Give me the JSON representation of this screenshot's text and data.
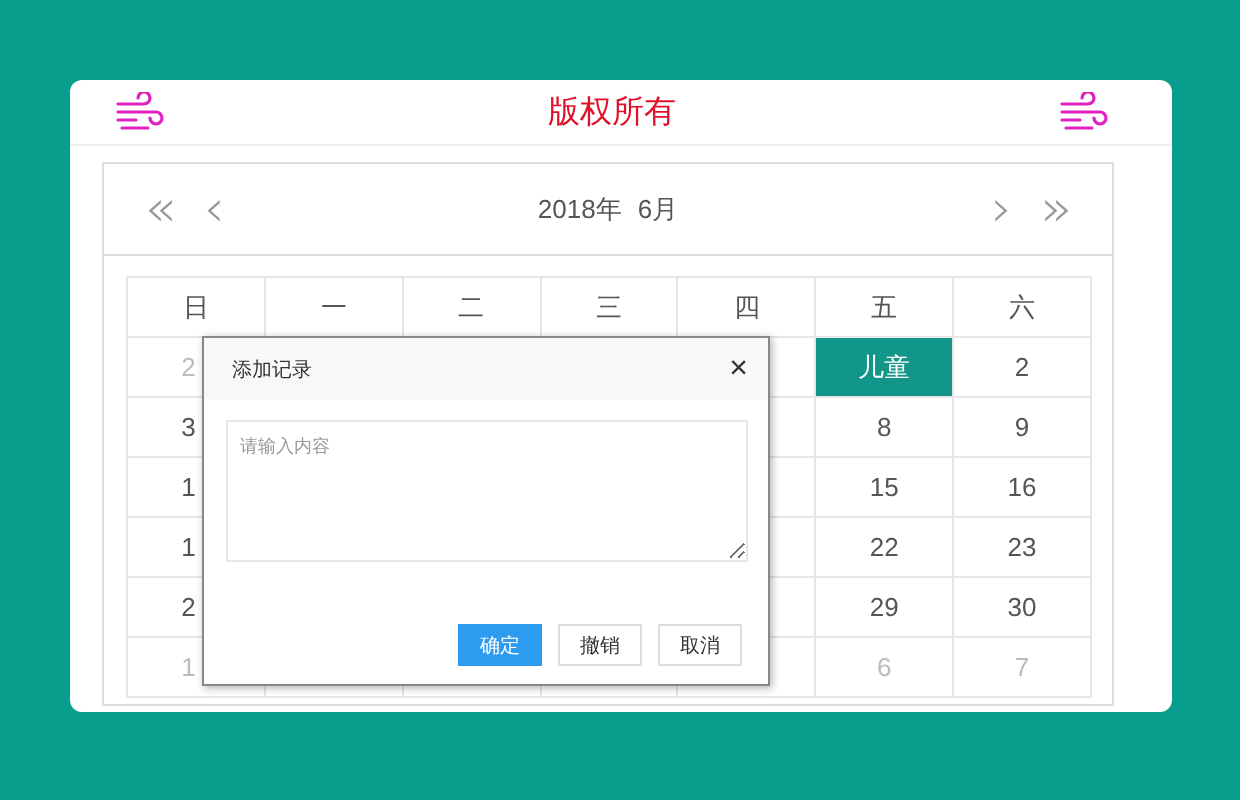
{
  "header": {
    "title": "版权所有"
  },
  "calendar": {
    "nav": {
      "prev_year": "«",
      "prev_month": "‹",
      "year": "2018年",
      "month": "6月",
      "next_month": "›",
      "next_year": "»"
    },
    "weekdays": [
      "日",
      "一",
      "二",
      "三",
      "四",
      "五",
      "六"
    ],
    "weeks": [
      {
        "sunday": {
          "text": "2",
          "muted": true,
          "selected": false
        },
        "friday": {
          "text": "儿童",
          "muted": false,
          "selected": true
        },
        "saturday": {
          "text": "2",
          "muted": false,
          "selected": false
        }
      },
      {
        "sunday": {
          "text": "3",
          "muted": false,
          "selected": false
        },
        "friday": {
          "text": "8",
          "muted": false,
          "selected": false
        },
        "saturday": {
          "text": "9",
          "muted": false,
          "selected": false
        }
      },
      {
        "sunday": {
          "text": "1",
          "muted": false,
          "selected": false
        },
        "friday": {
          "text": "15",
          "muted": false,
          "selected": false
        },
        "saturday": {
          "text": "16",
          "muted": false,
          "selected": false
        }
      },
      {
        "sunday": {
          "text": "1",
          "muted": false,
          "selected": false
        },
        "friday": {
          "text": "22",
          "muted": false,
          "selected": false
        },
        "saturday": {
          "text": "23",
          "muted": false,
          "selected": false
        }
      },
      {
        "sunday": {
          "text": "2",
          "muted": false,
          "selected": false
        },
        "friday": {
          "text": "29",
          "muted": false,
          "selected": false
        },
        "saturday": {
          "text": "30",
          "muted": false,
          "selected": false
        }
      },
      {
        "sunday": {
          "text": "1",
          "muted": true,
          "selected": false
        },
        "friday": {
          "text": "6",
          "muted": true,
          "selected": false
        },
        "saturday": {
          "text": "7",
          "muted": true,
          "selected": false
        }
      }
    ]
  },
  "dialog": {
    "title": "添加记录",
    "close": "×",
    "placeholder": "请输入内容",
    "buttons": [
      {
        "label": "确定",
        "kind": "primary"
      },
      {
        "label": "撤销",
        "kind": "default"
      },
      {
        "label": "取消",
        "kind": "default"
      }
    ]
  }
}
